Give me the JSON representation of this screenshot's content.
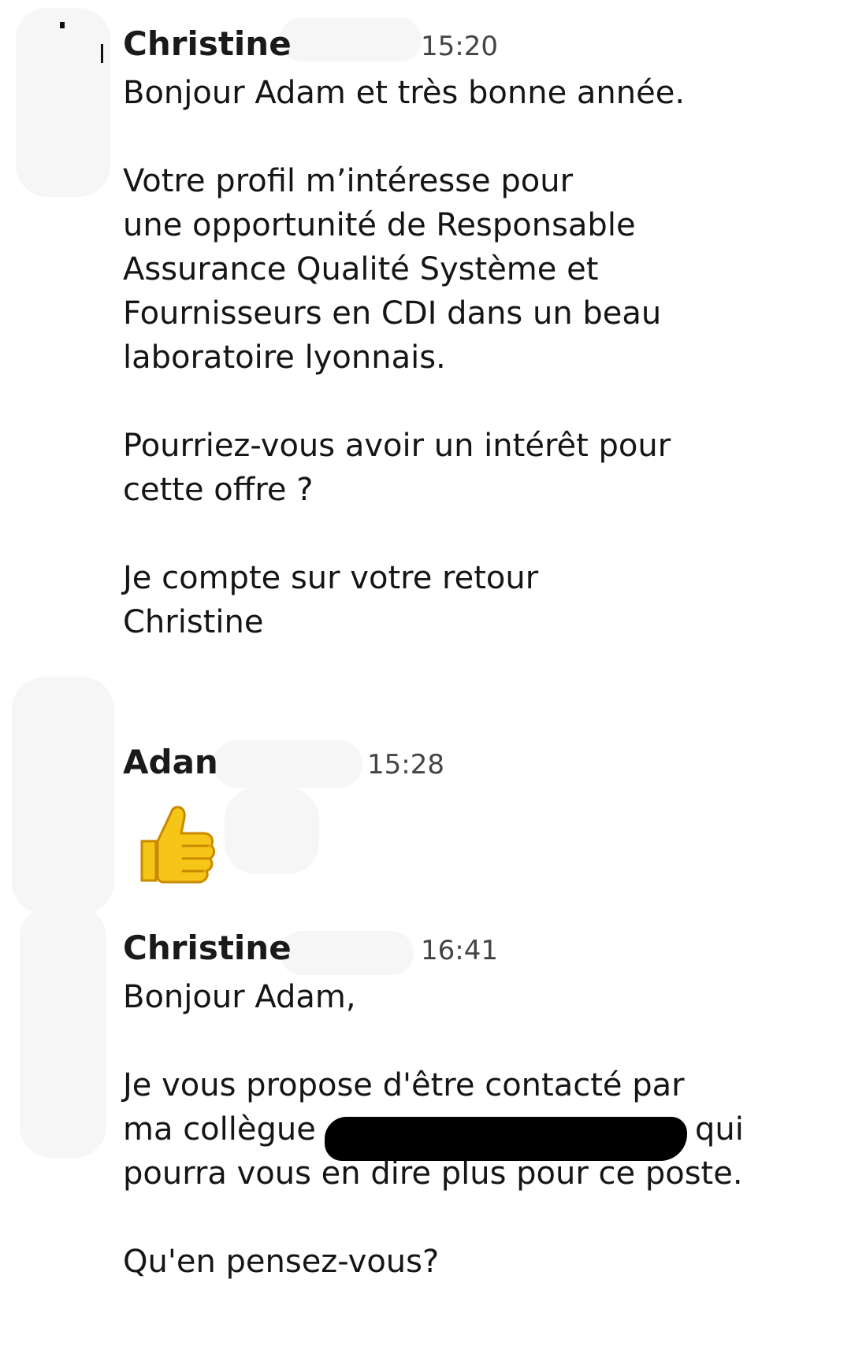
{
  "messages": [
    {
      "sender": "Christine",
      "time": "15:20",
      "body": "Bonjour Adam et très bonne année.\n\nVotre profil m’intéresse pour\nune opportunité de Responsable\nAssurance Qualité Système et\nFournisseurs en CDI dans un beau\nlaboratoire lyonnais.\n\nPourriez-vous avoir un intérêt pour\ncette offre ?\n\nJe compte sur votre retour\nChristine"
    },
    {
      "sender": "Adan",
      "time": "15:28",
      "emoji": "thumbs-up"
    },
    {
      "sender": "Christine",
      "time": "16:41",
      "body_line1": "Bonjour Adam,",
      "body_line2": "Je vous propose d'être contacté par",
      "body_line3_start": "ma collègue",
      "body_line3_end": "qui",
      "body_line4": "pourra vous en dire plus pour ce poste.",
      "body_line5": "Qu'en pensez-vous?"
    }
  ],
  "colors": {
    "background": "#ffffff",
    "text": "#151515",
    "timestamp": "#444444",
    "emoji": "#f5c518"
  }
}
